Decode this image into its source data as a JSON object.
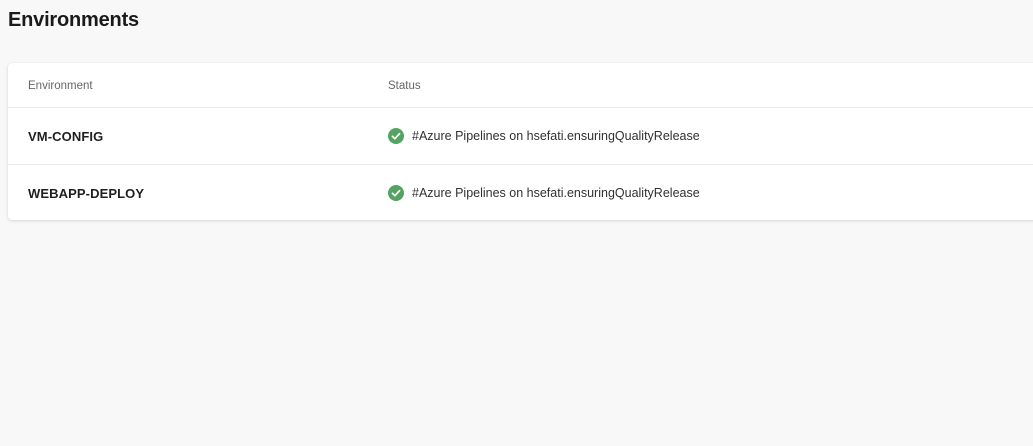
{
  "page": {
    "title": "Environments"
  },
  "table": {
    "columns": {
      "environment": "Environment",
      "status": "Status"
    },
    "rows": [
      {
        "environment": "VM-CONFIG",
        "status_icon": "success-check-icon",
        "status_text": "#Azure Pipelines on hsefati.ensuringQualityRelease"
      },
      {
        "environment": "WEBAPP-DEPLOY",
        "status_icon": "success-check-icon",
        "status_text": "#Azure Pipelines on hsefati.ensuringQualityRelease"
      }
    ]
  },
  "colors": {
    "success": "#55a362",
    "background": "#f8f8f8",
    "card": "#ffffff"
  }
}
